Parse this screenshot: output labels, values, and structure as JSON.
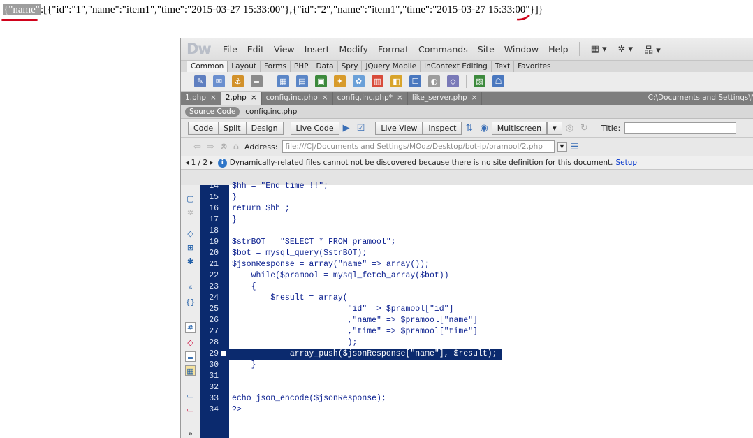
{
  "output": {
    "highlight": "{\"name\"",
    "rest": ":[{\"id\":\"1\",\"name\":\"item1\",\"time\":\"2015-03-27 15:33:00\"},{\"id\":\"2\",\"name\":\"item1\",\"time\":\"2015-03-27 15:33:00\"}]}"
  },
  "app": {
    "logo": "Dw"
  },
  "menu": [
    "File",
    "Edit",
    "View",
    "Insert",
    "Modify",
    "Format",
    "Commands",
    "Site",
    "Window",
    "Help"
  ],
  "insert_tabs": [
    "Common",
    "Layout",
    "Forms",
    "PHP",
    "Data",
    "Spry",
    "jQuery Mobile",
    "InContext Editing",
    "Text",
    "Favorites"
  ],
  "doc_tabs": [
    {
      "label": "1.php",
      "active": false
    },
    {
      "label": "2.php",
      "active": true
    },
    {
      "label": "config.inc.php",
      "active": false
    },
    {
      "label": "config.inc.php*",
      "active": false
    },
    {
      "label": "like_server.php",
      "active": false
    }
  ],
  "doc_path": "C:\\Documents and Settings\\M",
  "related": {
    "source_label": "Source Code",
    "file": "config.inc.php"
  },
  "doc_toolbar": {
    "code": "Code",
    "split": "Split",
    "design": "Design",
    "live_code": "Live Code",
    "live_view": "Live View",
    "inspect": "Inspect",
    "multiscreen": "Multiscreen",
    "title_label": "Title:"
  },
  "address": {
    "label": "Address:",
    "value": "file:///C|/Documents and Settings/MOdz/Desktop/bot-ip/pramool/2.php"
  },
  "info_bar": {
    "pager": "1 / 2",
    "message": "Dynamically-related files cannot not be discovered because there is no site definition for this document.",
    "link": "Setup"
  },
  "code_lines": [
    {
      "n": "14",
      "text": "$hh = \"End time !!\";"
    },
    {
      "n": "15",
      "text": "}"
    },
    {
      "n": "16",
      "text": "return $hh ;"
    },
    {
      "n": "17",
      "text": "}"
    },
    {
      "n": "18",
      "text": ""
    },
    {
      "n": "19",
      "text": "$strBOT = \"SELECT * FROM pramool\";"
    },
    {
      "n": "20",
      "text": "$bot = mysql_query($strBOT);"
    },
    {
      "n": "21",
      "text": "$jsonResponse = array(\"name\" => array());"
    },
    {
      "n": "22",
      "text": "    while($pramool = mysql_fetch_array($bot))"
    },
    {
      "n": "23",
      "text": "    {"
    },
    {
      "n": "24",
      "text": "        $result = array("
    },
    {
      "n": "25",
      "text": "                        \"id\" => $pramool[\"id\"]"
    },
    {
      "n": "26",
      "text": "                        ,\"name\" => $pramool[\"name\"]"
    },
    {
      "n": "27",
      "text": "                        ,\"time\" => $pramool[\"time\"]"
    },
    {
      "n": "28",
      "text": "                        );"
    },
    {
      "n": "29",
      "text": "            array_push($jsonResponse[\"name\"], $result);"
    },
    {
      "n": "30",
      "text": "    }"
    },
    {
      "n": "31",
      "text": ""
    },
    {
      "n": "32",
      "text": ""
    },
    {
      "n": "33",
      "text": "echo json_encode($jsonResponse);"
    },
    {
      "n": "34",
      "text": "?>"
    }
  ]
}
